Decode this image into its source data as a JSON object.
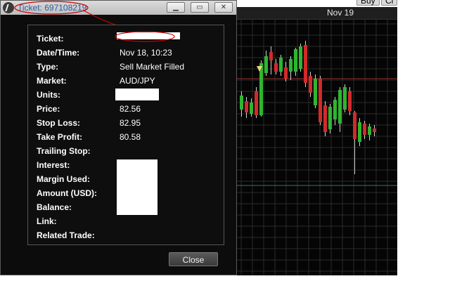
{
  "window": {
    "title": "Ticket: 697108219",
    "minimize_glyph": "▁",
    "maximize_glyph": "▭",
    "close_glyph": "✕"
  },
  "fields": [
    {
      "label": "Ticket:",
      "value": "",
      "redacted": true
    },
    {
      "label": "Date/Time:",
      "value": "Nov 18, 10:23"
    },
    {
      "label": "Type:",
      "value": "Sell Market Filled"
    },
    {
      "label": "Market:",
      "value": "AUD/JPY"
    },
    {
      "label": "Units:",
      "value": "",
      "redacted": true
    },
    {
      "label": "Price:",
      "value": "82.56"
    },
    {
      "label": "Stop Loss:",
      "value": "82.95"
    },
    {
      "label": "Take Profit:",
      "value": "80.58"
    },
    {
      "label": "Trailing Stop:",
      "value": ""
    },
    {
      "label": "Interest:",
      "value": "",
      "redacted": true
    },
    {
      "label": "Margin Used:",
      "value": "",
      "redacted": true
    },
    {
      "label": "Amount (USD):",
      "value": "",
      "redacted": true
    },
    {
      "label": "Balance:",
      "value": "",
      "redacted": true
    },
    {
      "label": "Link:",
      "value": ""
    },
    {
      "label": "Related Trade:",
      "value": ""
    }
  ],
  "close_label": "Close",
  "chart": {
    "top_buttons": [
      "Buy",
      "Cl"
    ],
    "date_label": "Nov 19",
    "colors": {
      "up": "#2fb52f",
      "down": "#d22a2a",
      "grid": "#2c2c2c",
      "stop_line": "#9b3030",
      "target_line": "#2e7f4f",
      "marker": "#e8d77a",
      "annotation": "#d00000"
    }
  }
}
